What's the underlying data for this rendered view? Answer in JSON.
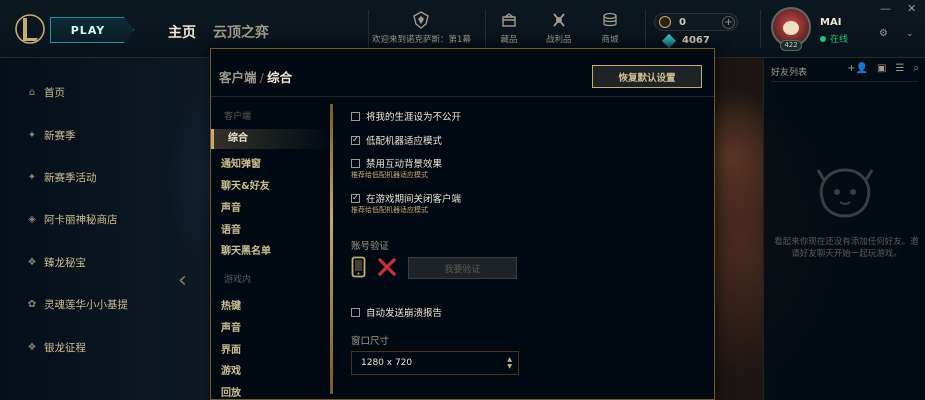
{
  "header": {
    "play_label": "PLAY",
    "nav_home": "主页",
    "nav_tft": "云顶之弈",
    "welcome": "欢迎来到诺克萨斯：第1幕",
    "store": "藏品",
    "loot": "战利品",
    "shop": "商城",
    "rp": "0",
    "be": "4067",
    "username": "MAI",
    "status": "在线",
    "level": "422"
  },
  "left_nav": {
    "items": [
      {
        "label": "首页",
        "icon": "home-icon"
      },
      {
        "label": "新赛季",
        "icon": "star-icon"
      },
      {
        "label": "新赛季活动",
        "icon": "star-icon"
      },
      {
        "label": "阿卡丽神秘商店",
        "icon": "shop-icon"
      },
      {
        "label": "臻龙秘宝",
        "icon": "dragon-icon"
      },
      {
        "label": "灵魂莲华小小基提",
        "icon": "flower-icon"
      },
      {
        "label": "银龙征程",
        "icon": "dragon-icon"
      }
    ]
  },
  "friends": {
    "title": "好友列表",
    "empty_text": "看起来你现在还没有添加任何好友。邀请好友聊天开始一起玩游戏。"
  },
  "modal": {
    "title_a": "客户端",
    "title_sep": "/",
    "title_b": "综合",
    "reset_label": "恢复默认设置",
    "sidebar": {
      "group1": "客户端",
      "items1": [
        "综合",
        "通知弹窗",
        "聊天&好友",
        "声音",
        "语音",
        "聊天黑名单"
      ],
      "group2": "游戏内",
      "items2": [
        "热键",
        "声音",
        "界面",
        "游戏",
        "回放"
      ]
    },
    "options": [
      {
        "label": "将我的生涯设为不公开",
        "checked": false,
        "mark": ""
      },
      {
        "label": "低配机器适应模式",
        "checked": true,
        "mark": "✓"
      },
      {
        "label": "禁用互动背景效果",
        "checked": false,
        "mark": "",
        "hint": "推荐给低配机器适应模式"
      },
      {
        "label": "在游戏期间关闭客户端",
        "checked": true,
        "mark": "✓",
        "hint": "推荐给低配机器适应模式"
      }
    ],
    "verify_section": "账号验证",
    "verify_button": "我要验证",
    "crash_report": {
      "label": "自动发送崩溃报告",
      "checked": false,
      "mark": ""
    },
    "window_size_label": "窗口尺寸",
    "window_size_value": "1280 x 720"
  }
}
